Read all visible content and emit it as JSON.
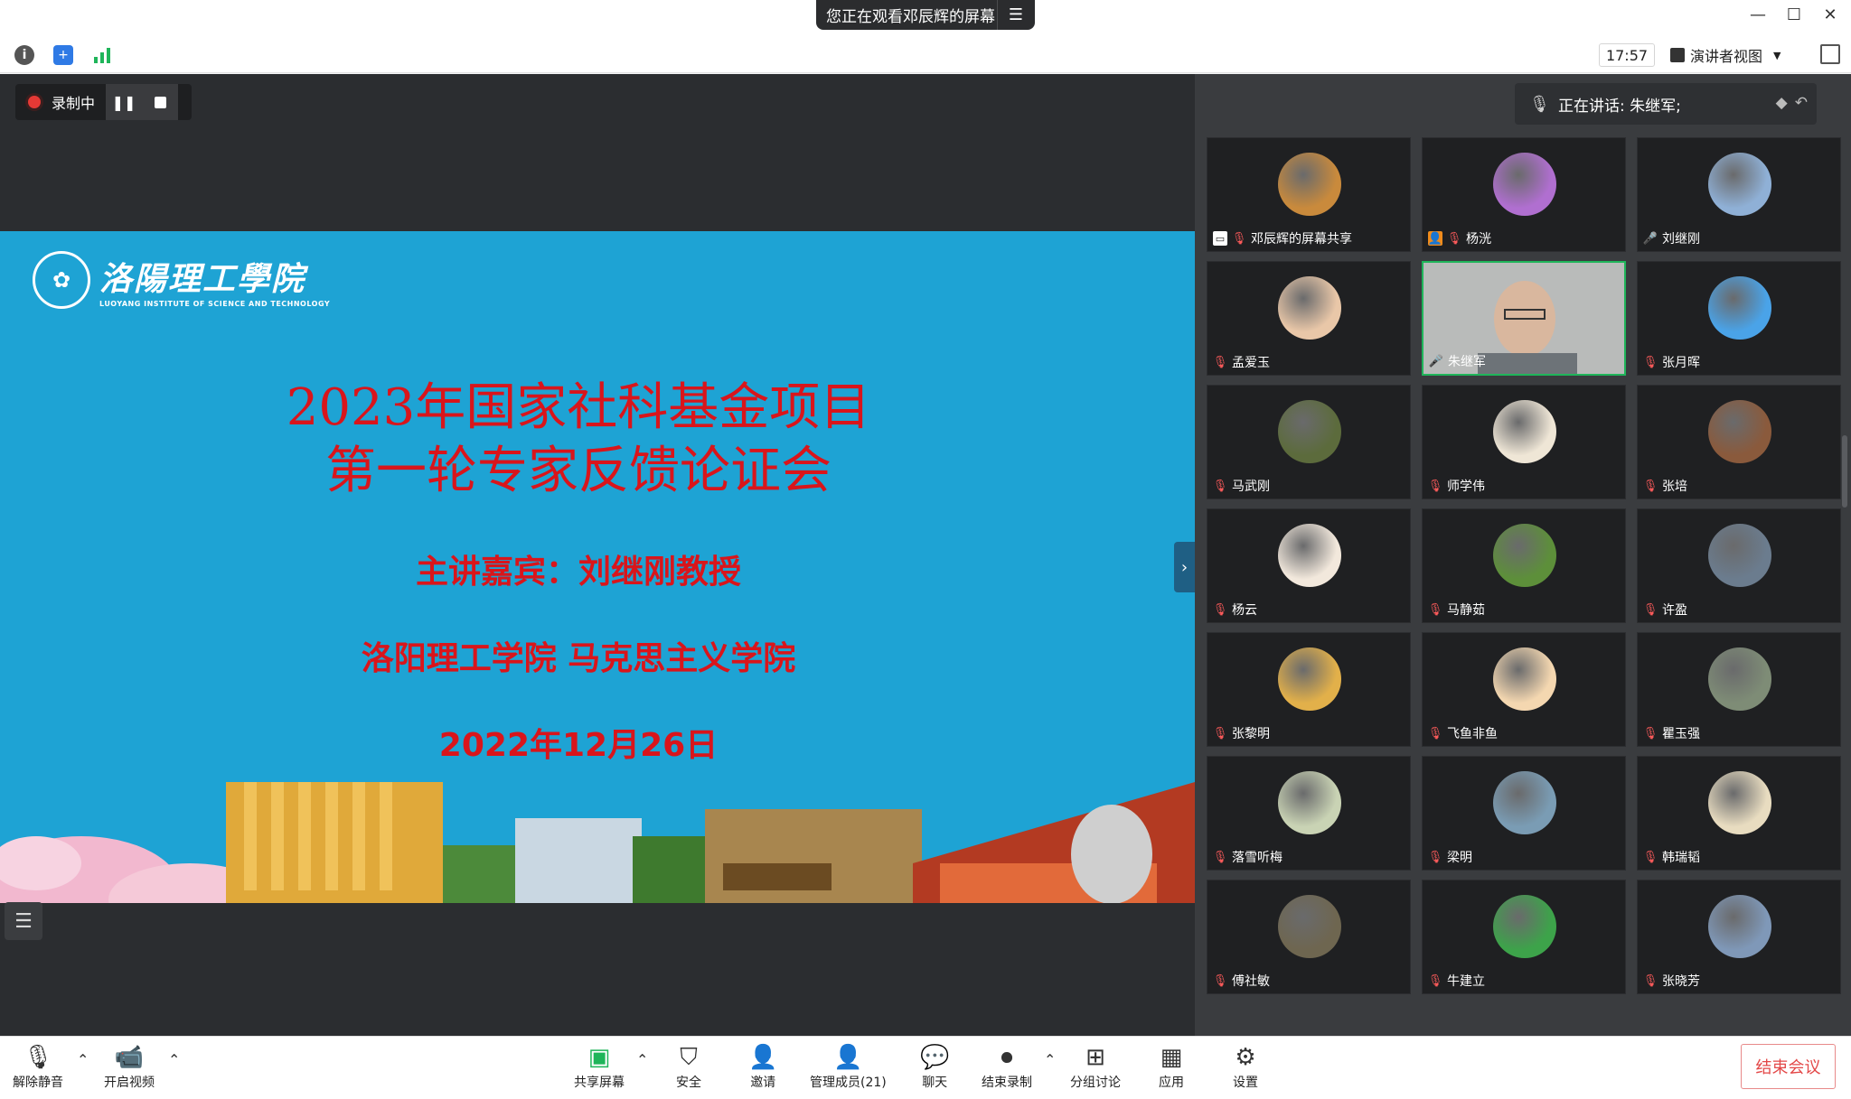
{
  "titlebar": {
    "share_notice": "您正在观看邓辰辉的屏幕",
    "menu_icon": "list-menu-icon"
  },
  "toolbar": {
    "time": "17:57",
    "view_mode": "演讲者视图"
  },
  "recording": {
    "label": "录制中"
  },
  "slide": {
    "school_cn": "洛陽理工學院",
    "school_en": "LUOYANG INSTITUTE OF SCIENCE AND TECHNOLOGY",
    "title_line1": "2023年国家社科基金项目",
    "title_line2": "第一轮专家反馈论证会",
    "speaker": "主讲嘉宾：刘继刚教授",
    "org": "洛阳理工学院 马克思主义学院",
    "date": "2022年12月26日"
  },
  "panel": {
    "speaking_now": "正在讲话: 朱继军;",
    "participants": [
      {
        "name": "邓辰辉的屏幕共享",
        "color": "#c98a3c",
        "icon": "screen-share"
      },
      {
        "name": "杨洸",
        "color": "#b06fd0",
        "icon": "host"
      },
      {
        "name": "刘继刚",
        "color": "#8fb0d6",
        "icon": "mic-on"
      },
      {
        "name": "孟爱玉",
        "color": "#e9c7a8",
        "icon": "muted"
      },
      {
        "name": "朱继军",
        "color": "#9a9c9b",
        "icon": "speaking"
      },
      {
        "name": "张月晖",
        "color": "#4aa3e8",
        "icon": "muted"
      },
      {
        "name": "马武刚",
        "color": "#5c6b3c",
        "icon": "muted"
      },
      {
        "name": "师学伟",
        "color": "#efe6d6",
        "icon": "muted"
      },
      {
        "name": "张培",
        "color": "#8a5a3c",
        "icon": "muted"
      },
      {
        "name": "杨云",
        "color": "#f2e8dc",
        "icon": "muted"
      },
      {
        "name": "马静茹",
        "color": "#5d8f3a",
        "icon": "muted"
      },
      {
        "name": "许盈",
        "color": "#6b7c8e",
        "icon": "muted"
      },
      {
        "name": "张黎明",
        "color": "#e2b04a",
        "icon": "muted"
      },
      {
        "name": "飞鱼非鱼",
        "color": "#f4d7b0",
        "icon": "muted"
      },
      {
        "name": "瞿玉强",
        "color": "#7e8c76",
        "icon": "muted"
      },
      {
        "name": "落雪听梅",
        "color": "#c9d3b4",
        "icon": "muted"
      },
      {
        "name": "梁明",
        "color": "#7a9cb4",
        "icon": "muted"
      },
      {
        "name": "韩瑞韬",
        "color": "#e8dcc0",
        "icon": "muted"
      },
      {
        "name": "傅社敏",
        "color": "#6e6650",
        "icon": "muted"
      },
      {
        "name": "牛建立",
        "color": "#3da34a",
        "icon": "muted"
      },
      {
        "name": "张晓芳",
        "color": "#7f98b8",
        "icon": "muted"
      }
    ]
  },
  "bottom": {
    "unmute": "解除静音",
    "start_video": "开启视频",
    "share_screen": "共享屏幕",
    "security": "安全",
    "invite": "邀请",
    "manage_members": "管理成员(21)",
    "chat": "聊天",
    "stop_recording": "结束录制",
    "breakout": "分组讨论",
    "apps": "应用",
    "settings": "设置",
    "end_meeting": "结束会议"
  },
  "colors": {
    "slide_bg": "#1ea3d4",
    "title_red": "#d9151b",
    "active_speaker": "#1fb55a",
    "end_red": "#e34848"
  }
}
